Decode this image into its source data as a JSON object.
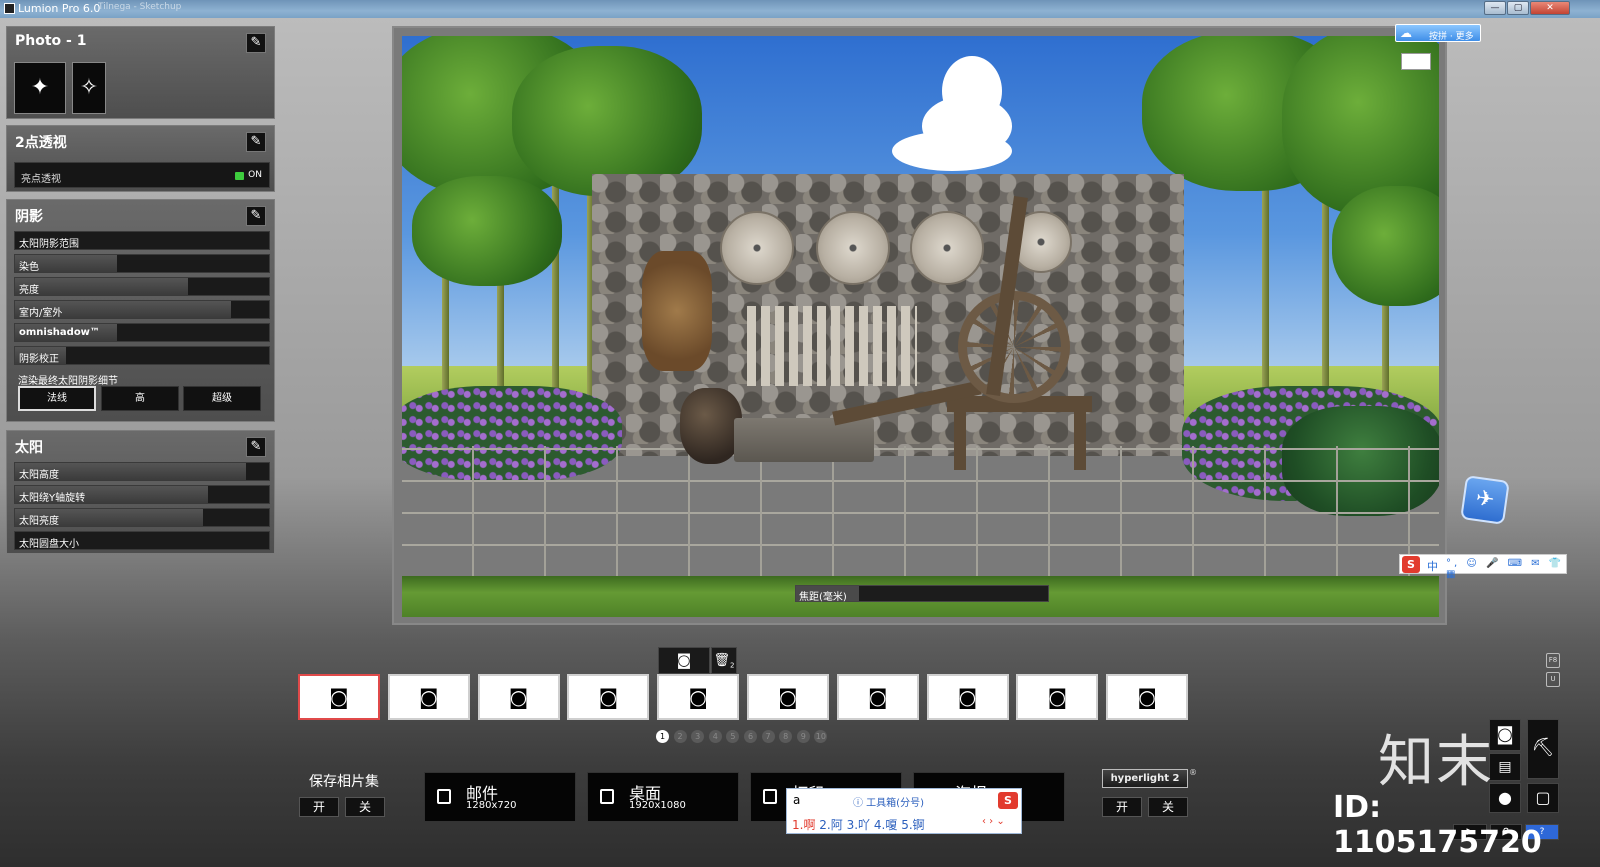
{
  "window": {
    "title": "Lumion Pro 6.0",
    "blurred_tab": "Tilnega - Sketchup",
    "controls": [
      "—",
      "▢",
      "✕"
    ]
  },
  "panels": {
    "photo": {
      "title": "Photo - 1",
      "effect_tiles": [
        {
          "icon": "sparkle-stars-icon",
          "glyph": "✦"
        },
        {
          "icon": "person-stars-icon",
          "glyph": "✧"
        }
      ]
    },
    "two_point": {
      "title": "2点透视",
      "toggle_label": "亮点透视",
      "toggle_state": "ON"
    },
    "shadow": {
      "title": "阴影",
      "sliders": [
        {
          "label": "太阳阴影范围",
          "level": 0.0
        },
        {
          "label": "染色",
          "level": 0.4
        },
        {
          "label": "亮度",
          "level": 0.68
        },
        {
          "label": "室内/室外",
          "level": 0.85
        },
        {
          "label": "omnishadow™",
          "level": 0.4
        },
        {
          "label": "阴影校正",
          "level": 0.2
        }
      ],
      "quality_label": "渲染最终太阳阴影细节",
      "quality_options": [
        "法线",
        "高",
        "超级"
      ],
      "quality_selected": "法线"
    },
    "sun": {
      "title": "太阳",
      "sliders": [
        {
          "label": "太阳高度",
          "level": 0.91
        },
        {
          "label": "太阳绕Y轴旋转",
          "level": 0.76
        },
        {
          "label": "太阳亮度",
          "level": 0.74
        },
        {
          "label": "太阳圆盘大小",
          "level": 0.0
        }
      ]
    }
  },
  "viewport": {
    "focal_label": "焦距(毫米)",
    "focal_level": 0.25
  },
  "overlays": {
    "baidu_label": "按拼 · 更多",
    "ime_zh": "中",
    "ime_icons": "°, ☺ 🎤 ⌨ ✉ 👕 ▦"
  },
  "photo_strip": {
    "capture_icon": "camera-icon",
    "delete_badge": "2",
    "slot_count": 10,
    "selected_slot": 1,
    "pages": [
      "1",
      "2",
      "3",
      "4",
      "5",
      "6",
      "7",
      "8",
      "9",
      "10"
    ],
    "active_page": "1"
  },
  "bottom": {
    "save_album_label": "保存相片集",
    "save_on": "开",
    "save_off": "关",
    "render_buttons": [
      {
        "title": "邮件",
        "sub": "1280x720"
      },
      {
        "title": "桌面",
        "sub": "1920x1080"
      },
      {
        "title": "打印",
        "sub": ""
      },
      {
        "title": "海报",
        "sub": ""
      }
    ],
    "hyperlight_label": "hyperlight 2",
    "hyperlight_mark": "®",
    "hyperlight_on": "开",
    "hyperlight_off": "关"
  },
  "ime_candidates": {
    "input": "a",
    "toolbox": "ⓘ 工具箱(分号)",
    "candidates": [
      {
        "num": "1.",
        "word": "啊"
      },
      {
        "num": "2.",
        "word": "阿"
      },
      {
        "num": "3.",
        "word": "吖"
      },
      {
        "num": "4.",
        "word": "嗄"
      },
      {
        "num": "5.",
        "word": "锕"
      }
    ],
    "nav": "‹ › ⌄"
  },
  "side_keys": [
    "F8",
    "U"
  ],
  "watermark": {
    "logo": "知末",
    "id": "ID: 1105175720"
  },
  "colors": {
    "accent_red": "#e04a4a",
    "toggle_green": "#3dcc3d",
    "ime_blue": "#2b5fbd",
    "sogou_red": "#e23b2e"
  }
}
